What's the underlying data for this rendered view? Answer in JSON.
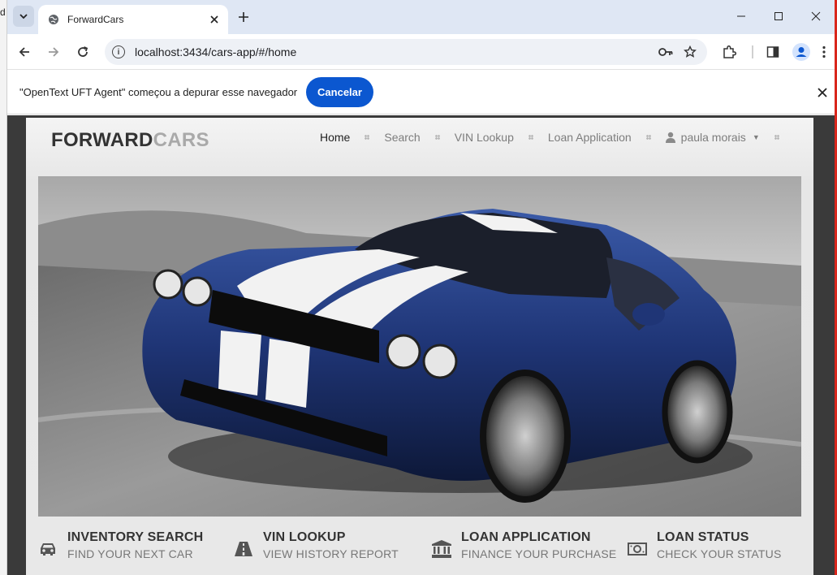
{
  "background": {
    "left_fragment": "d"
  },
  "browser": {
    "tab": {
      "title": "ForwardCars"
    },
    "address": {
      "url": "localhost:3434/cars-app/#/home"
    },
    "accent": "#0b57d0"
  },
  "infobar": {
    "message": "\"OpenText UFT Agent\" começou a depurar esse navegador",
    "cancel_label": "Cancelar"
  },
  "site": {
    "brand": {
      "part1": "FORWARD",
      "part2": "CARS"
    },
    "nav": {
      "home": "Home",
      "search": "Search",
      "vin": "VIN Lookup",
      "loan": "Loan Application",
      "user": "paula morais"
    },
    "features": [
      {
        "title": "INVENTORY SEARCH",
        "subtitle": "FIND YOUR NEXT CAR",
        "icon": "car-icon"
      },
      {
        "title": "VIN LOOKUP",
        "subtitle": "VIEW HISTORY REPORT",
        "icon": "road-icon"
      },
      {
        "title": "LOAN APPLICATION",
        "subtitle": "FINANCE YOUR PURCHASE",
        "icon": "bank-icon"
      },
      {
        "title": "LOAN STATUS",
        "subtitle": "CHECK YOUR STATUS",
        "icon": "money-icon"
      }
    ]
  }
}
